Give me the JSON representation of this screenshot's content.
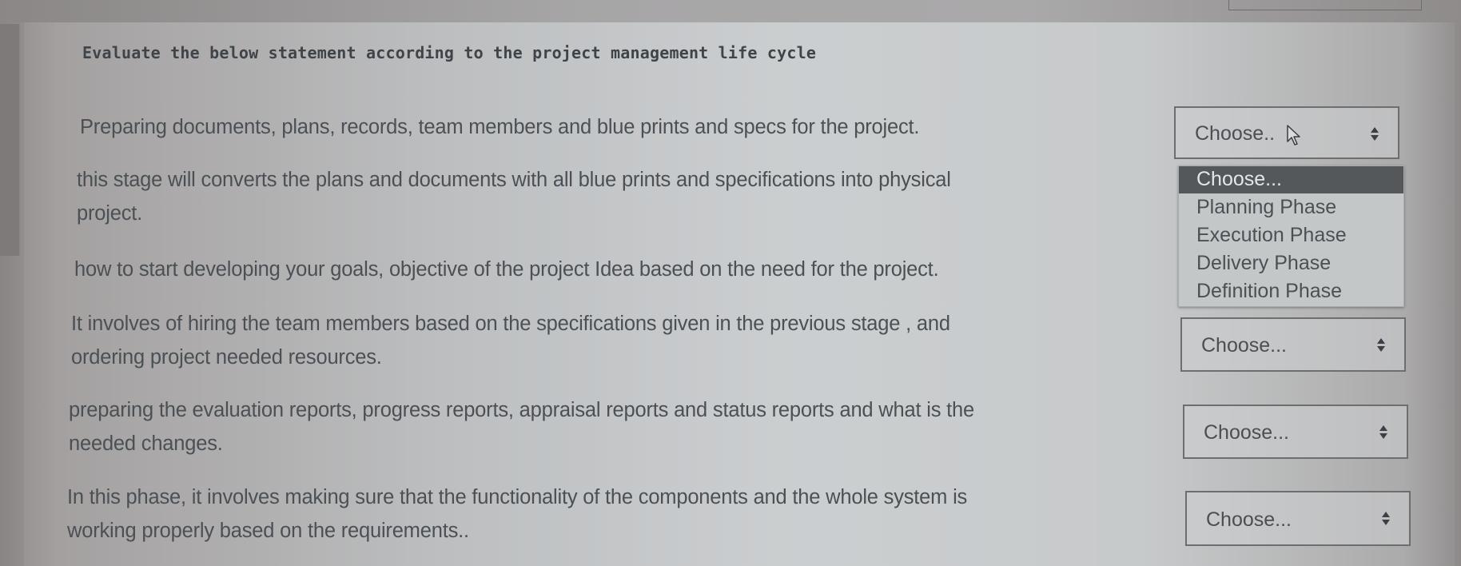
{
  "question": {
    "instruction": "Evaluate the below statement according to the project management life cycle"
  },
  "statements": [
    {
      "lines": [
        "Preparing documents, plans, records, team members and  blue prints and specs for the project."
      ]
    },
    {
      "lines": [
        "this stage will converts the plans and documents with all blue prints and specifications into physical",
        "project."
      ]
    },
    {
      "lines": [
        "how to start developing your goals, objective of the project Idea based on the  need for the project."
      ]
    },
    {
      "lines": [
        "It involves of hiring the team members based on the specifications given in the previous stage , and",
        "ordering project needed resources."
      ]
    },
    {
      "lines": [
        "preparing the evaluation reports, progress reports, appraisal reports and status reports and what is the",
        "needed changes."
      ]
    },
    {
      "lines": [
        "In this phase, it involves making sure that the functionality of the components and the whole system is",
        "working properly based on the requirements.."
      ]
    }
  ],
  "selects": [
    {
      "value": "Choose.."
    },
    {
      "value": "Choose..."
    },
    {
      "value": "Choose..."
    },
    {
      "value": "Choose..."
    }
  ],
  "dropdown": {
    "options": [
      "Choose...",
      "Planning Phase",
      "Execution Phase",
      "Delivery Phase",
      "Definition Phase"
    ],
    "highlighted_index": 0
  },
  "icons": {
    "select_arrows": "up-down-arrows-icon",
    "pointer": "mouse-cursor-icon"
  },
  "colors": {
    "text": "#4a5054",
    "dropdown_highlight": "#55585b",
    "select_border": "#6c6e70"
  }
}
